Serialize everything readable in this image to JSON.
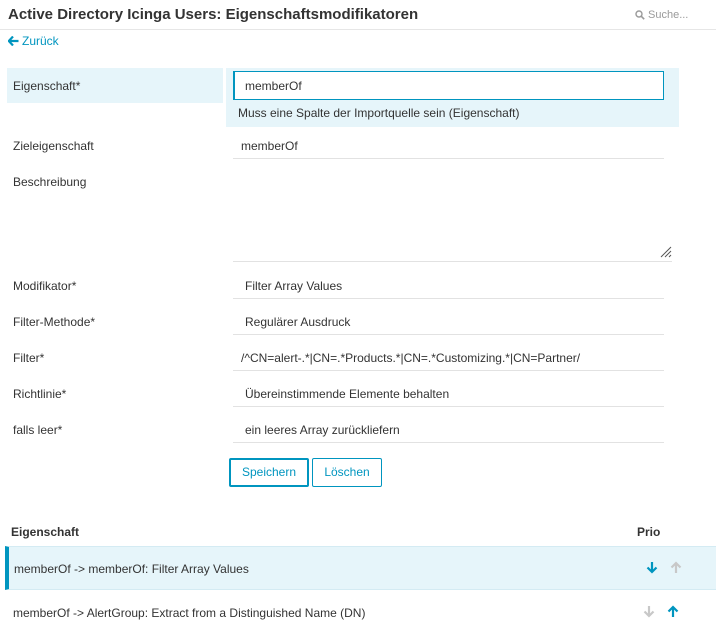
{
  "header": {
    "title": "Active Directory Icinga Users: Eigenschaftsmodifikatoren",
    "search_placeholder": "Suche..."
  },
  "back_label": "Zurück",
  "form": {
    "property": {
      "label": "Eigenschaft*",
      "value": "memberOf",
      "hint": "Muss eine Spalte der Importquelle sein (Eigenschaft)"
    },
    "target_property": {
      "label": "Zieleigenschaft",
      "value": "memberOf"
    },
    "description": {
      "label": "Beschreibung",
      "value": ""
    },
    "modifier": {
      "label": "Modifikator*",
      "value": "Filter Array Values"
    },
    "filter_method": {
      "label": "Filter-Methode*",
      "value": "Regulärer Ausdruck"
    },
    "filter": {
      "label": "Filter*",
      "value": "/^CN=alert-.*|CN=.*Products.*|CN=.*Customizing.*|CN=Partner/"
    },
    "policy": {
      "label": "Richtlinie*",
      "value": "Übereinstimmende Elemente behalten"
    },
    "when_empty": {
      "label": "falls leer*",
      "value": "ein leeres Array zurückliefern"
    }
  },
  "buttons": {
    "save": "Speichern",
    "delete": "Löschen"
  },
  "table": {
    "headers": {
      "property": "Eigenschaft",
      "prio": "Prio"
    },
    "rows": [
      {
        "text": "memberOf -> memberOf: Filter Array Values"
      },
      {
        "text": "memberOf -> AlertGroup: Extract from a Distinguished Name (DN)"
      }
    ]
  },
  "colors": {
    "accent": "#0095bf",
    "highlight": "#e6f5fa",
    "disabled": "#c8c8c8"
  }
}
